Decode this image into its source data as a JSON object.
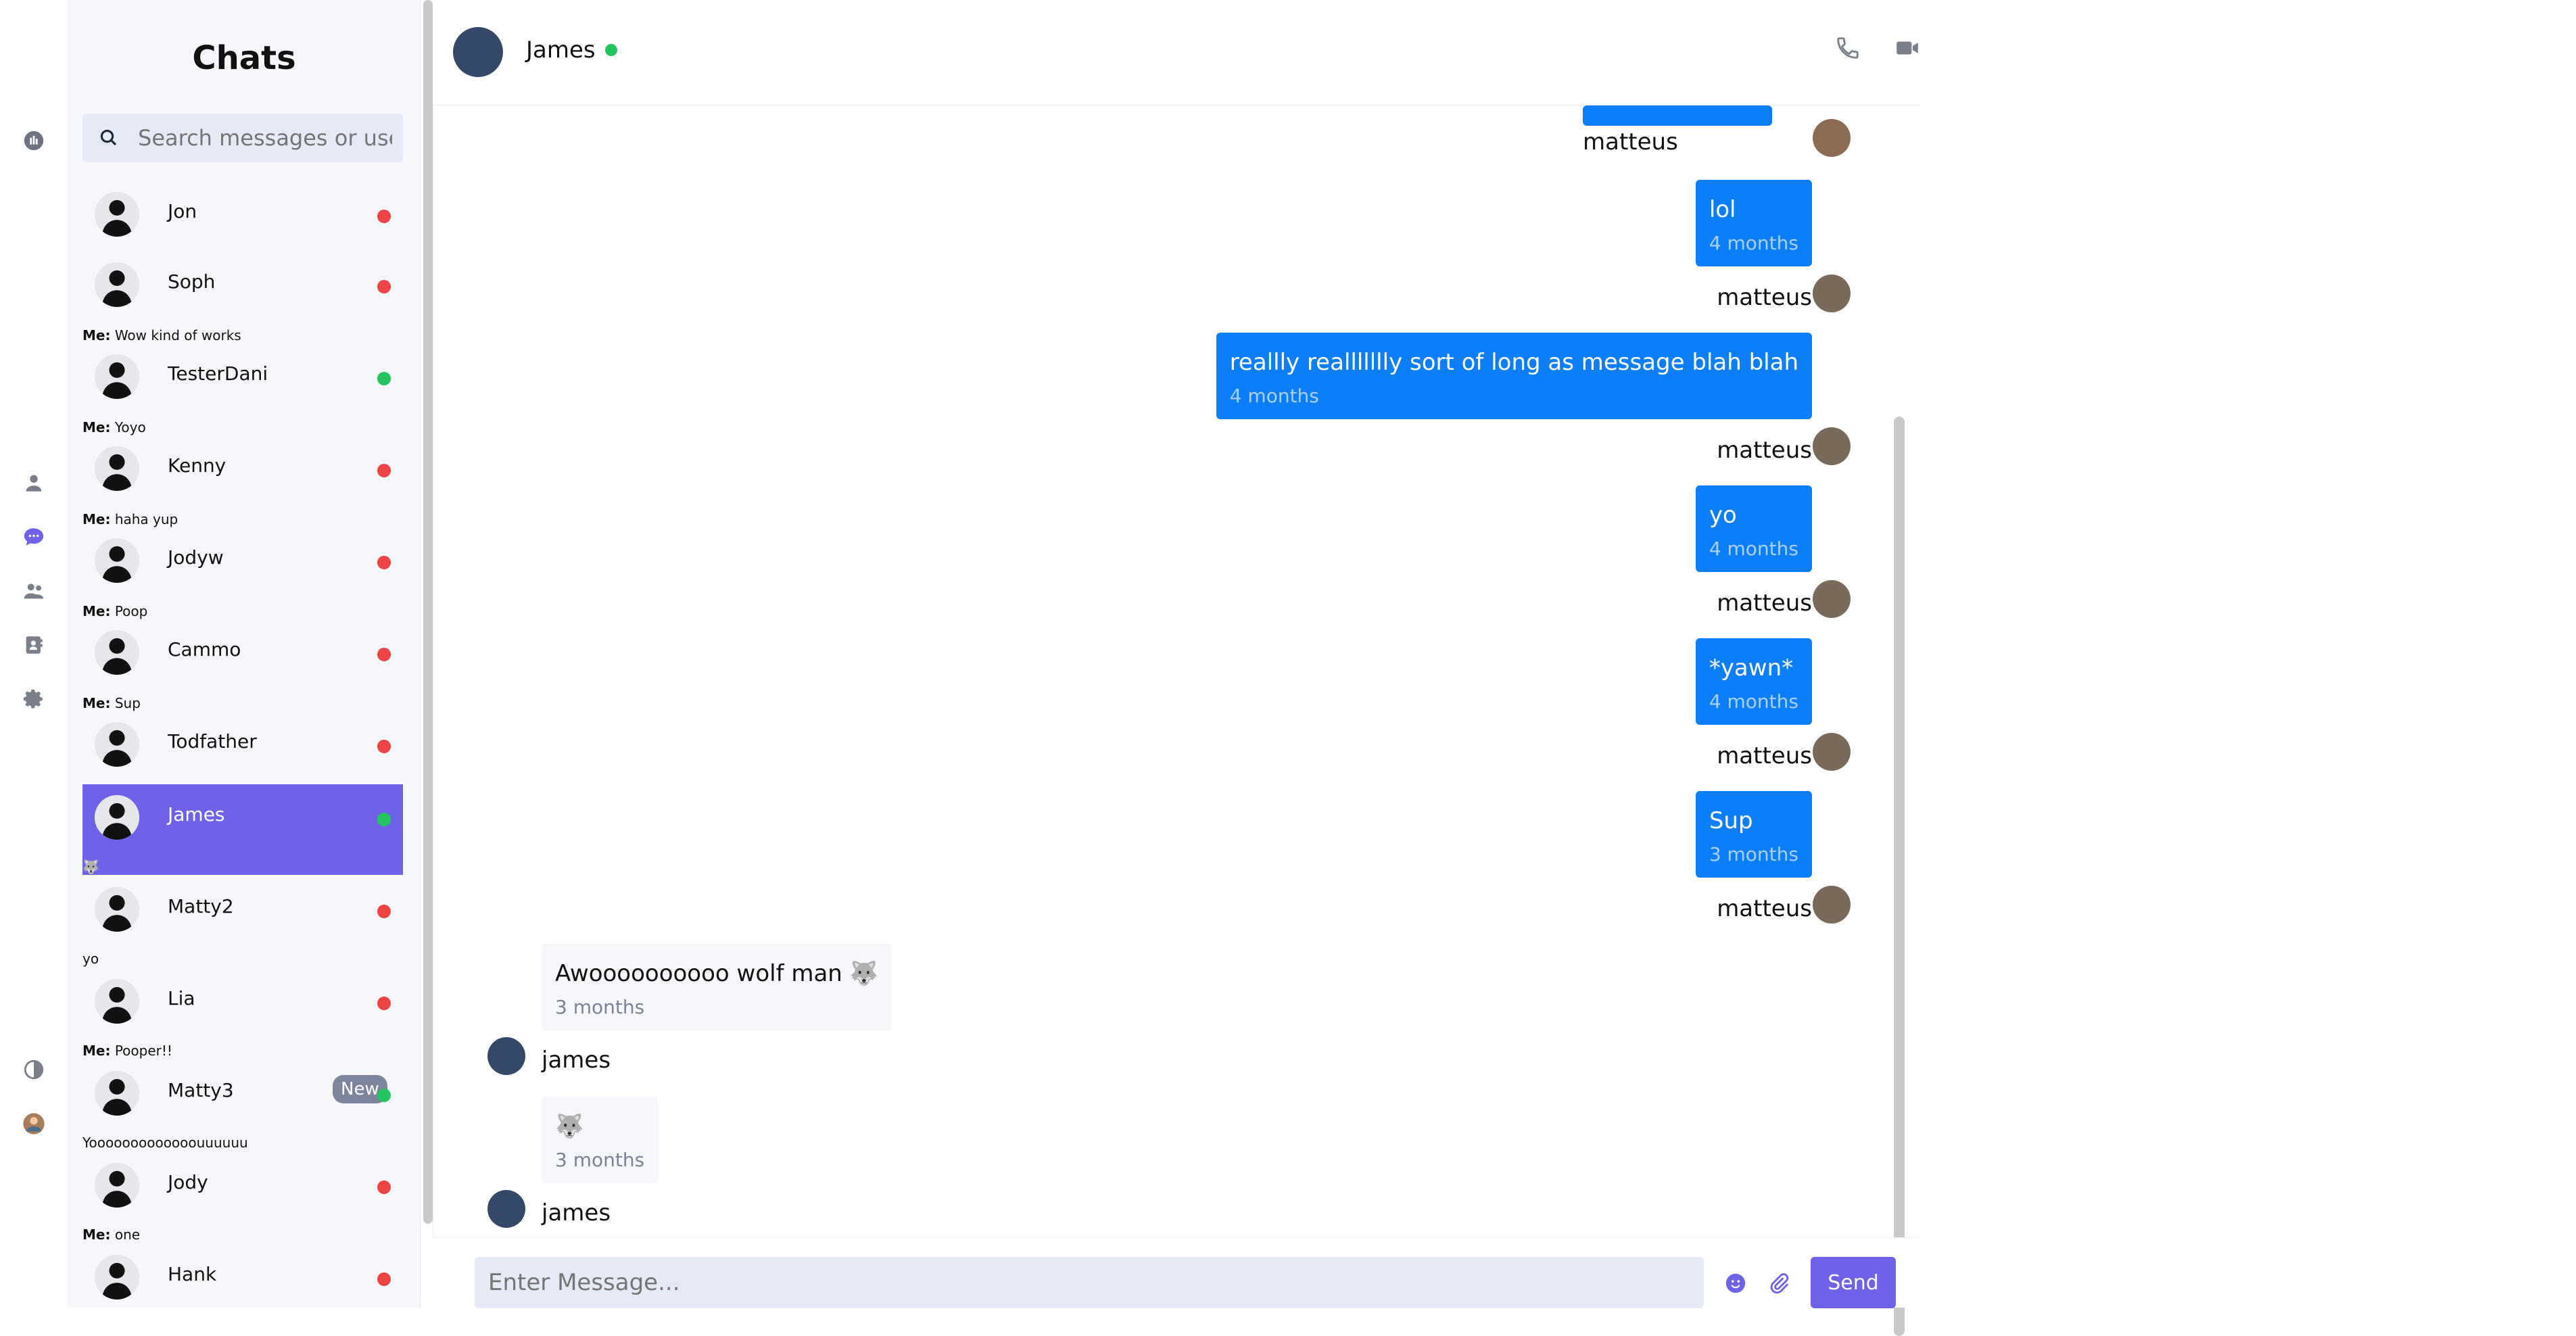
{
  "sidebar_title": "Chats",
  "search": {
    "placeholder": "Search messages or users"
  },
  "contacts": [
    {
      "name": "Jon",
      "status": "offline"
    },
    {
      "name": "Soph",
      "status": "offline",
      "preview_me": "Me:",
      "preview": "Wow kind of works"
    },
    {
      "name": "TesterDani",
      "status": "online",
      "preview_me": "Me:",
      "preview": "Yoyo"
    },
    {
      "name": "Kenny",
      "status": "offline",
      "preview_me": "Me:",
      "preview": "haha yup"
    },
    {
      "name": "Jodyw",
      "status": "offline",
      "preview_me": "Me:",
      "preview": "Poop"
    },
    {
      "name": "Cammo",
      "status": "offline",
      "preview_me": "Me:",
      "preview": "Sup"
    },
    {
      "name": "Todfather",
      "status": "offline"
    },
    {
      "name": "James",
      "status": "online",
      "active": true,
      "preview": "🐺"
    },
    {
      "name": "Matty2",
      "status": "offline",
      "preview": "yo"
    },
    {
      "name": "Lia",
      "status": "offline",
      "preview_me": "Me:",
      "preview": "Pooper!!"
    },
    {
      "name": "Matty3",
      "status": "online",
      "badge": "New",
      "preview": "Yooooooooooooouuuuuu"
    },
    {
      "name": "Jody",
      "status": "offline",
      "preview_me": "Me:",
      "preview": "one"
    },
    {
      "name": "Hank",
      "status": "offline"
    }
  ],
  "header": {
    "name": "James"
  },
  "messages": [
    {
      "direction": "out",
      "text": "lol",
      "time": "4 months",
      "sender": "matteus"
    },
    {
      "direction": "out",
      "text": "reallly reallllllly sort of long as message blah blah",
      "time": "4 months",
      "sender": "matteus"
    },
    {
      "direction": "out",
      "text": "yo",
      "time": "4 months",
      "sender": "matteus"
    },
    {
      "direction": "out",
      "text": "*yawn*",
      "time": "4 months",
      "sender": "matteus"
    },
    {
      "direction": "out",
      "text": "Sup",
      "time": "3 months",
      "sender": "matteus"
    },
    {
      "direction": "in",
      "text": "Awoooooooooo wolf man 🐺",
      "time": "3 months",
      "sender": "james"
    },
    {
      "direction": "in",
      "text": "🐺",
      "time": "3 months",
      "sender": "james"
    }
  ],
  "top_sender": "matteus",
  "composer": {
    "placeholder": "Enter Message...",
    "send_label": "Send"
  },
  "colors": {
    "accent": "#6f61e8",
    "bubble_out": "#0d7ef9",
    "online": "#22c55e",
    "offline": "#ef4444"
  }
}
